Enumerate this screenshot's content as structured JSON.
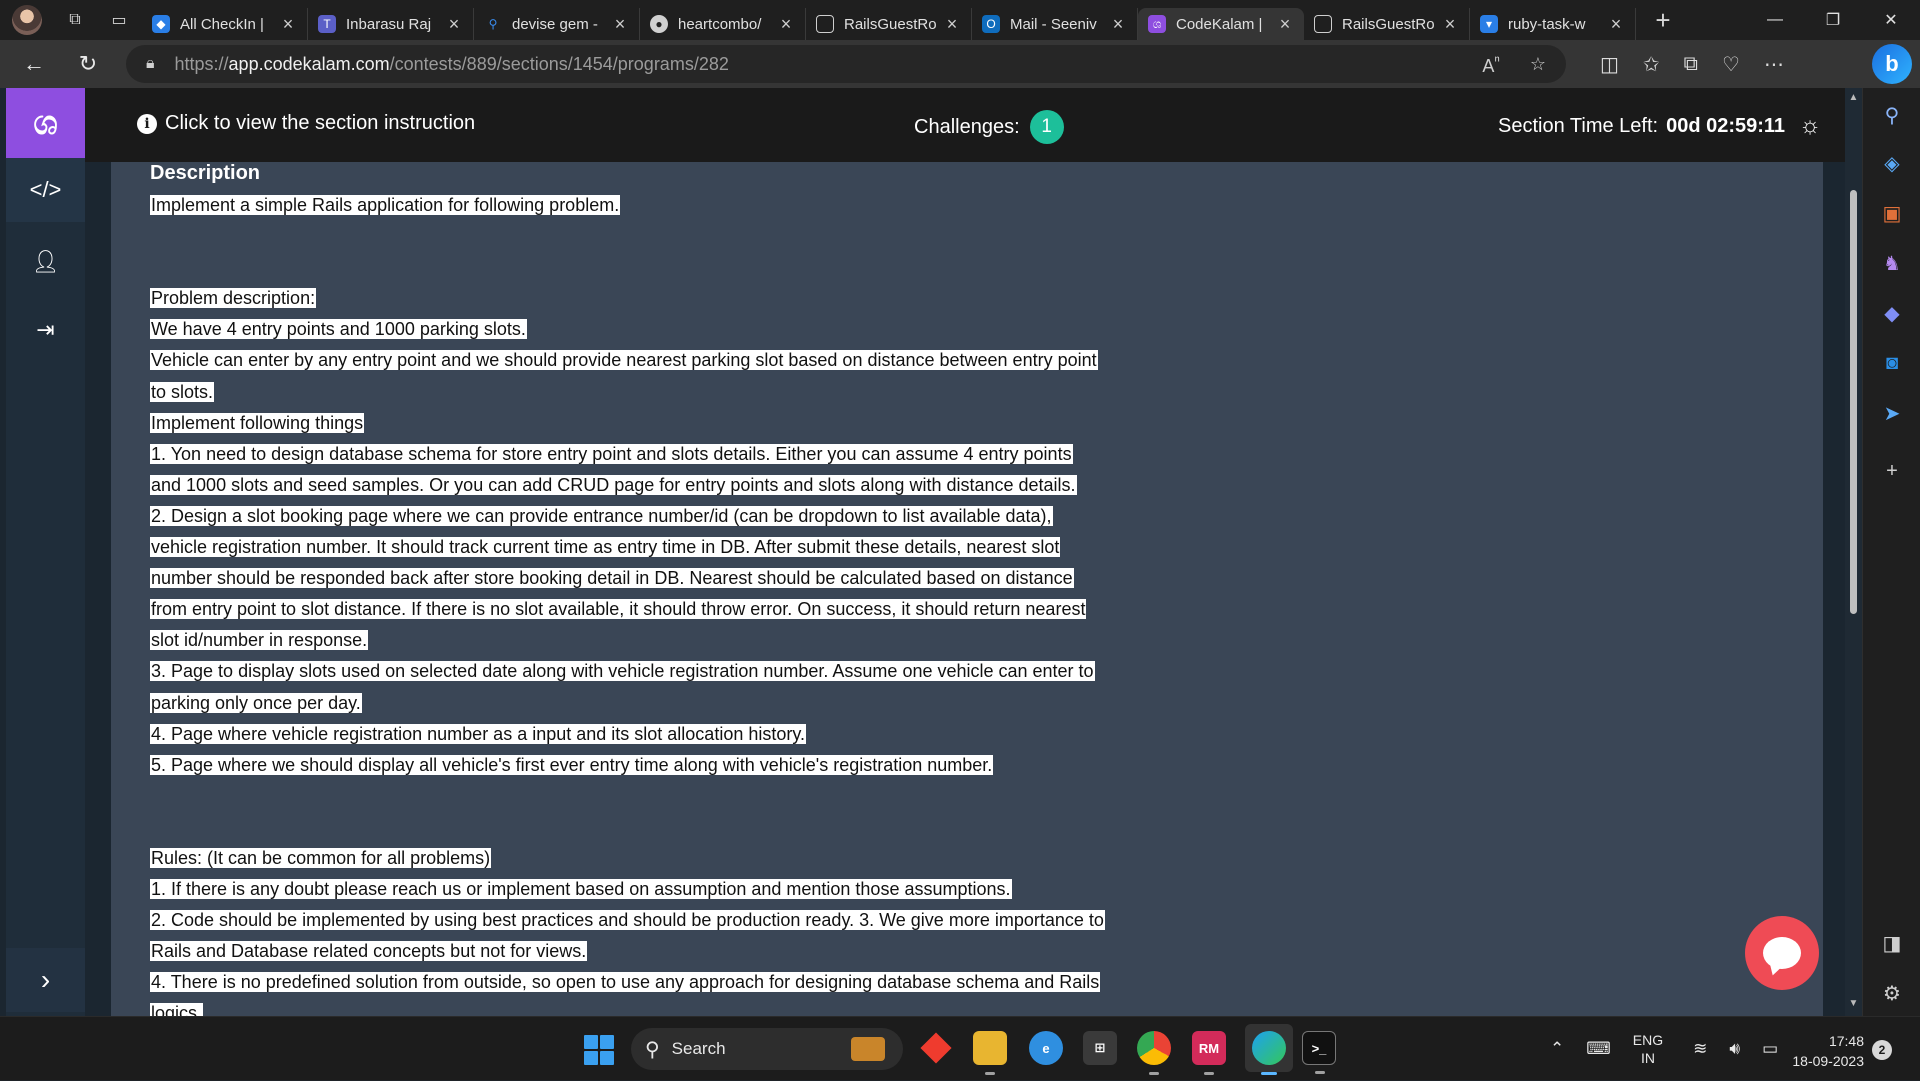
{
  "browser": {
    "tabs": [
      {
        "label": "All CheckIn |",
        "favicon": "azure-devops-icon",
        "color": "#2a7ee6",
        "active": false
      },
      {
        "label": "Inbarasu Raj",
        "favicon": "teams-icon",
        "color": "#5b5fc7",
        "active": false
      },
      {
        "label": "devise gem -",
        "favicon": "search-icon",
        "color": "#3a3a3a",
        "active": false
      },
      {
        "label": "heartcombo/",
        "favicon": "github-icon",
        "color": "#3a3a3a",
        "active": false
      },
      {
        "label": "RailsGuestRo",
        "favicon": "page-icon",
        "color": "#3a3a3a",
        "active": false
      },
      {
        "label": "Mail - Seeniv",
        "favicon": "outlook-icon",
        "color": "#0f6cbd",
        "active": false
      },
      {
        "label": "CodeKalam |",
        "favicon": "codekalam-icon",
        "color": "#8e4ee0",
        "active": true
      },
      {
        "label": "RailsGuestRo",
        "favicon": "page-icon",
        "color": "#3a3a3a",
        "active": false
      },
      {
        "label": "ruby-task-w",
        "favicon": "bookmark-icon",
        "color": "#2a7ee6",
        "active": false
      }
    ],
    "url_prefix": "https://",
    "url_host": "app.codekalam.com",
    "url_path": "/contests/889/sections/1454/programs/282"
  },
  "header": {
    "instruction": "Click to view the section instruction",
    "challenges_label": "Challenges:",
    "challenges_count": "1",
    "time_label": "Section Time Left:",
    "time_value": "00d 02:59:11"
  },
  "description": {
    "title": "Description",
    "intro": "Implement a simple Rails application for following problem.",
    "lines": [
      "Problem description:",
      "We have 4 entry points and 1000 parking slots.",
      "Vehicle can enter by any entry point and we should provide nearest parking slot based on distance between entry point",
      "to slots.",
      "Implement following things",
      "1. Yon need to design database schema for store entry point and slots details. Either you can assume 4 entry points",
      "and 1000 slots and seed samples. Or you can add CRUD page for entry points and slots along with distance details.",
      "2. Design a slot booking page where we can provide entrance number/id (can be dropdown to list available data),",
      "vehicle registration number. It should track current time as entry time in DB. After submit these details, nearest slot",
      "number should be responded back after store booking detail in DB. Nearest should be calculated based on distance",
      "from entry point to slot distance. If there is no slot available, it should throw error. On success, it should return nearest",
      "slot id/number in response.",
      "3. Page to display slots used on selected date along with vehicle registration number. Assume one vehicle can enter to",
      "parking only once per day.",
      "4. Page where vehicle registration number as a input and its slot allocation history.",
      "5. Page where we should display all vehicle's first ever entry time along with vehicle's registration number."
    ],
    "rules": [
      "Rules: (It can be common for all problems)",
      "1. If there is any doubt please reach us or implement based on assumption and mention those assumptions.",
      "2. Code should be implemented by using best practices and should be production ready. 3. We give more importance to",
      "Rails and Database related concepts but not for views.",
      "4. There is no predefined solution from outside, so open to use any approach for designing database schema and Rails",
      "logics."
    ]
  },
  "taskbar": {
    "search_label": "Search",
    "lang_top": "ENG",
    "lang_bottom": "IN",
    "time": "17:48",
    "date": "18-09-2023",
    "notifications": "2"
  },
  "colors": {
    "brand": "#8e4ee0",
    "badge": "#1dbf9a",
    "chat": "#ef4b55"
  }
}
